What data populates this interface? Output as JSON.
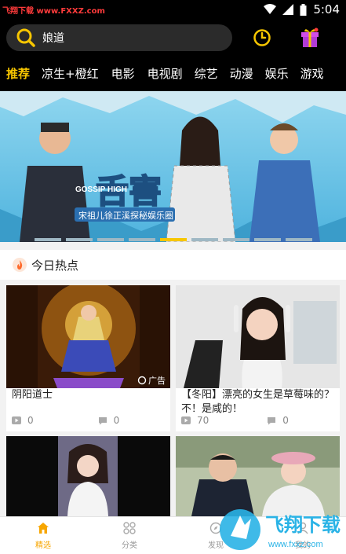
{
  "status": {
    "watermark": "飞翔下载 www.FXXZ.com",
    "time": "5:04"
  },
  "search": {
    "query": "娘道"
  },
  "categories": [
    {
      "label": "推荐",
      "active": true
    },
    {
      "label": "凉生+橙红",
      "active": false
    },
    {
      "label": "电影",
      "active": false
    },
    {
      "label": "电视剧",
      "active": false
    },
    {
      "label": "综艺",
      "active": false
    },
    {
      "label": "动漫",
      "active": false
    },
    {
      "label": "娱乐",
      "active": false
    },
    {
      "label": "游戏",
      "active": false
    }
  ],
  "banner": {
    "logo_text": "舌害",
    "logo_en": "GOSSIP HIGH",
    "subtitle": "宋祖儿徐正溪探秘娱乐圈",
    "page_count": 9,
    "active_page": 5
  },
  "hot": {
    "title": "今日热点"
  },
  "cards": [
    {
      "title": "阴阳道士",
      "ad_label": "广告",
      "plays": "0",
      "comments": "0"
    },
    {
      "title": "【冬阳】漂亮的女生是草莓味的？不！是咸的！",
      "plays": "70",
      "comments": "0"
    },
    {
      "title": "",
      "plays": "",
      "comments": ""
    },
    {
      "title": "",
      "plays": "",
      "comments": ""
    }
  ],
  "nav": [
    {
      "label": "精选",
      "icon": "home-icon",
      "active": true
    },
    {
      "label": "分类",
      "icon": "grid-icon",
      "active": false
    },
    {
      "label": "发现",
      "icon": "discover-icon",
      "active": false
    },
    {
      "label": "我的",
      "icon": "user-icon",
      "active": false
    }
  ],
  "watermark_logo": {
    "cn": "飞翔下载",
    "url": "www.fxxz.com"
  },
  "colors": {
    "accent": "#f7c600",
    "header_bg": "#000000",
    "banner_bg": "#6fc7e9"
  }
}
